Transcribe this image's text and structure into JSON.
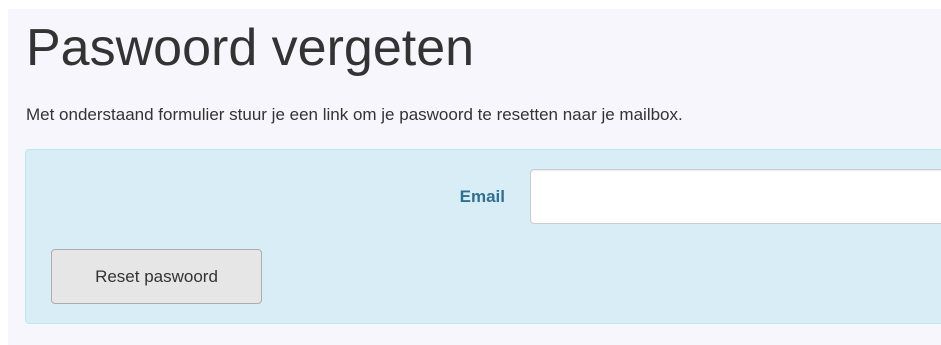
{
  "page": {
    "title": "Paswoord vergeten",
    "intro": "Met onderstaand formulier stuur je een link om je paswoord te resetten naar je mailbox."
  },
  "form": {
    "email_label": "Email",
    "email_value": "",
    "submit_label": "Reset paswoord"
  },
  "colors": {
    "panel_background": "#d9edf7",
    "panel_border": "#bce8f1",
    "label_color": "#31708f",
    "button_background": "#e6e6e6"
  }
}
